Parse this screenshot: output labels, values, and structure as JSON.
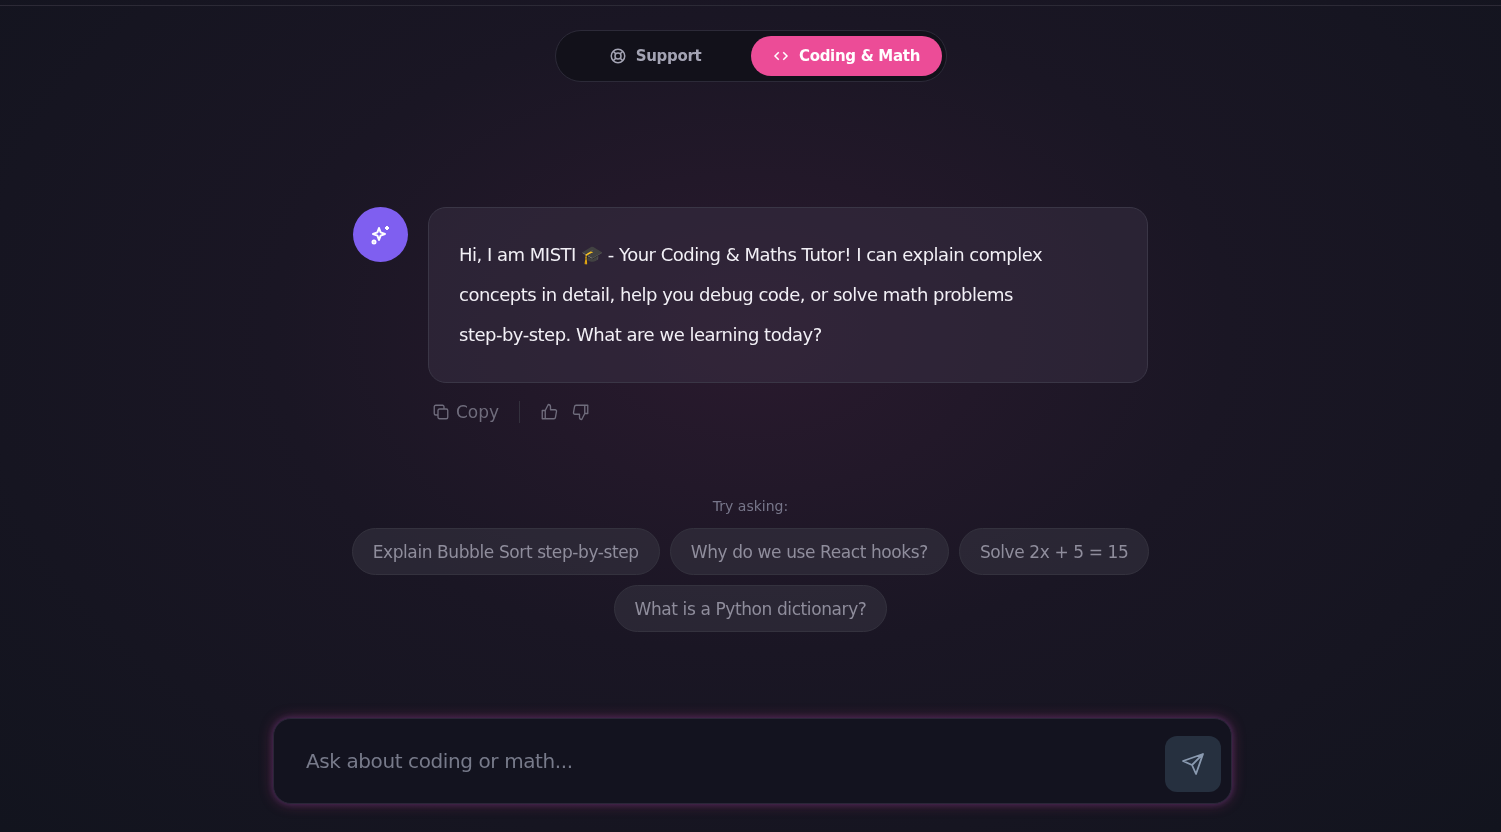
{
  "tabs": [
    {
      "label": "Support",
      "selected": false
    },
    {
      "label": "Coding & Math",
      "selected": true
    }
  ],
  "message": {
    "text": "Hi, I am MISTI 🎓 - Your Coding & Maths Tutor! I can explain complex concepts in detail, help you debug code, or solve math problems step-by-step. What are we learning today?",
    "copy_label": "Copy"
  },
  "suggestions": {
    "title": "Try asking:",
    "items": [
      "Explain Bubble Sort step-by-step",
      "Why do we use React hooks?",
      "Solve 2x + 5 = 15",
      "What is a Python dictionary?"
    ]
  },
  "input": {
    "placeholder": "Ask about coding or math..."
  }
}
